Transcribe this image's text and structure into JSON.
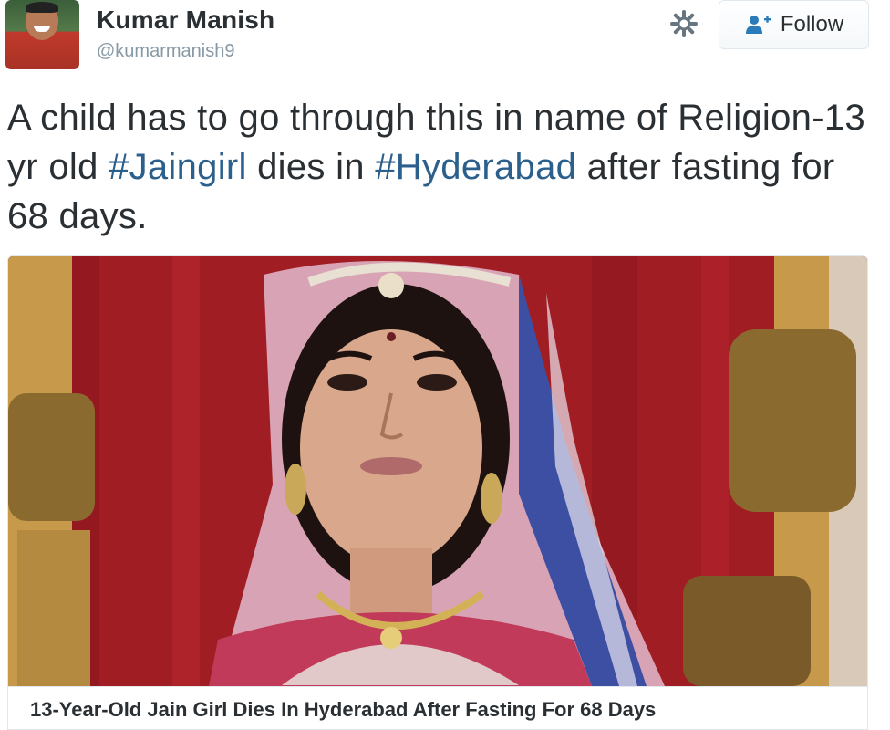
{
  "user": {
    "name": "Kumar Manish",
    "handle": "@kumarmanish9"
  },
  "actions": {
    "settings_icon": "gear-icon",
    "follow_icon": "user-add-icon",
    "follow_label": "Follow"
  },
  "tweet": {
    "text_1": "A child has to go through this in name of Religion-13 yr old ",
    "hashtag_1": "#Jaingirl",
    "text_2": " dies in ",
    "hashtag_2": "#Hyderabad",
    "text_3": " after fasting for 68 days."
  },
  "card": {
    "title": "13-Year-Old Jain Girl Dies In Hyderabad After Fasting For 68 Days"
  },
  "colors": {
    "text": "#292f33",
    "muted": "#8899a6",
    "link": "#2b5f8c",
    "follow_icon": "#2b7bb9",
    "border": "#e1e8ed"
  }
}
